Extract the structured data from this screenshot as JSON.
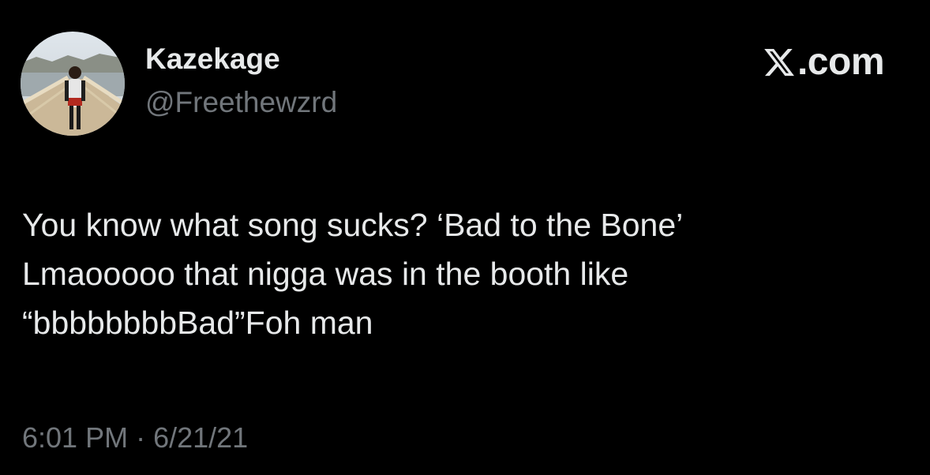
{
  "author": {
    "display_name": "Kazekage",
    "handle": "@Freethewzrd",
    "avatar_icon": "profile-photo"
  },
  "brand": {
    "logo_icon": "x-logo-icon",
    "suffix": ".com"
  },
  "tweet": {
    "lines": [
      "You know what song sucks? ‘Bad to the Bone’",
      "Lmaooooo that nigga was in the booth like",
      "“bbbbbbbbBad”Foh man"
    ]
  },
  "meta": {
    "time": "6:01 PM",
    "separator": "·",
    "date": "6/21/21"
  },
  "colors": {
    "background": "#000000",
    "primary_text": "#e7e9ea",
    "secondary_text": "#71767b"
  }
}
